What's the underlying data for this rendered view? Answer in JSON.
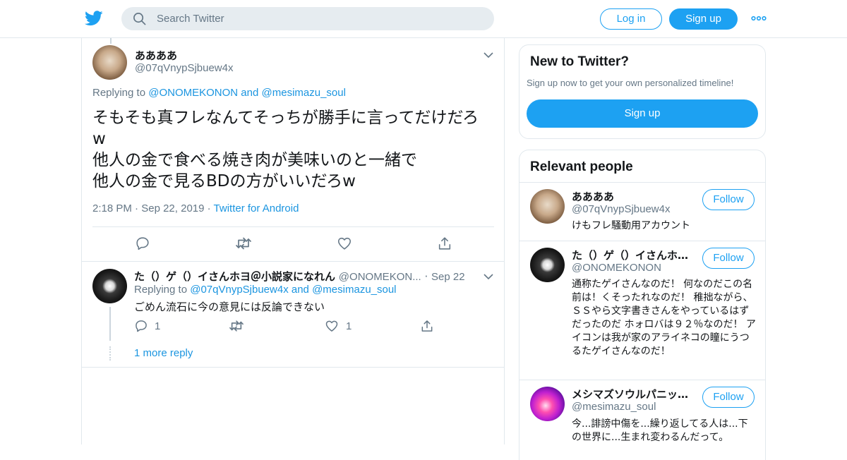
{
  "colors": {
    "accent": "#1da1f2",
    "link": "#1b95e0",
    "secondary_text": "#657786",
    "border": "#e1e8ed"
  },
  "header": {
    "logo_icon": "twitter-bird-icon",
    "search_placeholder": "Search Twitter",
    "login_label": "Log in",
    "signup_label": "Sign up",
    "more_icon": "more-dots-icon"
  },
  "main_tweet": {
    "name": "ああああ",
    "handle": "@07qVnypSjbuew4x",
    "replying_prefix": "Replying to ",
    "replying_user1": "@ONOMEKONON",
    "replying_and": " and ",
    "replying_user2": "@mesimazu_soul",
    "text": "そもそも真フレなんてそっちが勝手に言ってだけだろw\n他人の金で食べる焼き肉が美味いのと一緒で\n他人の金で見るBDの方がいいだろw",
    "time": "2:18 PM",
    "date": "Sep 22, 2019",
    "source": "Twitter for Android",
    "separator": "·"
  },
  "reply_tweet": {
    "name": "た（）ゲ（）イさんホヨ＠小説家になれん",
    "handle": "@ONOMEKON...",
    "separator": "·",
    "date": "Sep 22",
    "replying_prefix": "Replying to ",
    "replying_user1": "@07qVnypSjbuew4x",
    "replying_and": " and ",
    "replying_user2": "@mesimazu_soul",
    "text": "ごめん流石に今の意見には反論できない",
    "reply_count": "1",
    "like_count": "1",
    "more_replies": "1 more reply"
  },
  "sidebar": {
    "new_title": "New to Twitter?",
    "new_subtitle": "Sign up now to get your own personalized timeline!",
    "signup_label": "Sign up",
    "relevant_title": "Relevant people",
    "follow_label": "Follow",
    "people": [
      {
        "name": "ああああ",
        "handle": "@07qVnypSjbuew4x",
        "bio": "けもフレ騒動用アカウント"
      },
      {
        "name": "た（）ゲ（）イさんホ…",
        "handle": "@ONOMEKONON",
        "bio": "通称たゲイさんなのだ！ 何なのだこの名前は！くそったれなのだ！ 稚拙ながら、ＳＳやら文字書きさんをやっているはずだったのだ ホォロバは９２％なのだ！ アイコンは我が家のアライネコの瞳にうつるたゲイさんなのだ！"
      },
      {
        "name": "メシマズソウルパニッ…",
        "handle": "@mesimazu_soul",
        "bio": "今...誹謗中傷を...繰り返してる人は...下の世界に...生まれ変わるんだって。"
      }
    ]
  }
}
